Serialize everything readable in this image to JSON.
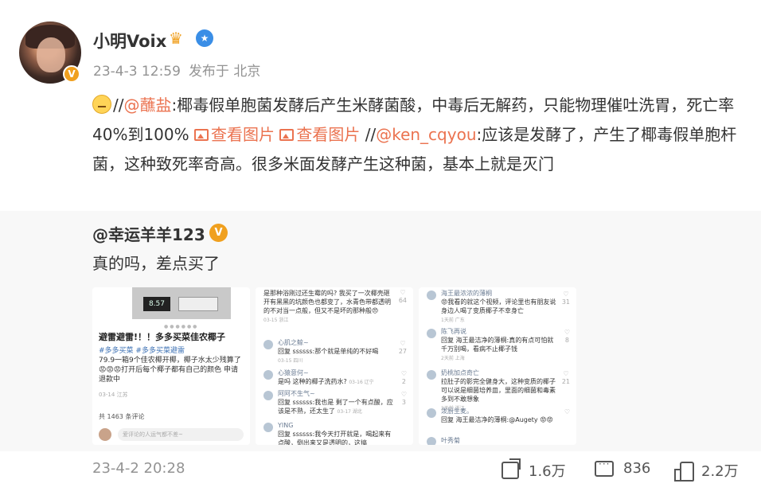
{
  "author": {
    "name": "小明Voix",
    "time": "23-4-3 12:59",
    "source": "发布于 北京"
  },
  "post": {
    "part1": "//",
    "mention1": "@蘸盐",
    "text1": ":椰毒假单胞菌发酵后产生米酵菌酸，中毒后无解药，只能物理催吐洗胃，死亡率40%到100% ",
    "img1": "查看图片",
    "img2": "查看图片",
    "sep": " //",
    "mention2": "@ken_cqyou",
    "text2": ":应该是发酵了，产生了椰毒假单胞杆菌，这种致死率奇高。很多米面发酵产生这种菌，基本上就是灭门"
  },
  "repost": {
    "user": "@幸运羊羊123",
    "text": "真的吗，差点买了",
    "thumb1": {
      "scale_reading": "8.57",
      "title": "避雷避雷!！！多多买菜佳农椰子",
      "tags": "#多多买菜 #多多买菜避雷",
      "body": "79.9一箱9个佳农椰开椰，椰子水太少残算了 😡😡😡打开后每个椰子都有自己的颜色 申请退款中",
      "date": "03-14 江苏",
      "count": "共 1463 条评论",
      "input": "爱评论的人运气都不差~"
    },
    "thumb2": {
      "lines": [
        {
          "name": "",
          "text": "是那种浴刚过还生霉的吗? 我买了一次椰壳砸开有黑黑的坑颜色也都变了，水青色带都透明的不对当一点般，但又不是坏的那种般😠",
          "meta": "03-15 浙江",
          "likes": "64"
        },
        {
          "name": "心肌之鲸~",
          "text": "回复 ssssss:那个就是单纯的不好喝",
          "meta": "03-15 四川",
          "likes": "27"
        },
        {
          "name": "心猿意何~",
          "text": "是吗 这种的椰子洗药水?",
          "meta": "03-16 辽宁",
          "likes": "2"
        },
        {
          "name": "阿阿不生气~",
          "text": "回复 ssssss:我也是 剩了一个有点酸，应该是不熟，还太生了",
          "meta": "03-17 湖北",
          "likes": "3"
        },
        {
          "name": "YING",
          "text": "回复 ssssss:我今天打开就是，喝起来有点酸，倒出来又是透明的，这搞",
          "meta": "",
          "likes": ""
        }
      ]
    },
    "thumb3": {
      "lines": [
        {
          "name": "海王最浓浓的薄桐",
          "text": "😡我看的就这个视频，评论里也有朋友说身边人喝了变质椰子不幸身亡",
          "meta": "1天前 广东",
          "likes": "31"
        },
        {
          "name": "陈飞再说",
          "text": "回复 海王最洁净的薄桐:真的有点可怕就千万别喝，看病不止椰子钱",
          "meta": "2天前 上海",
          "likes": "8"
        },
        {
          "name": "奶桃加点奇亡",
          "text": "拉肚子的影完全健身大，这种变质的椰子可以说是细菌培养皿，里面的细菌和毒素多到不敢想象",
          "meta": "2天前 浙江",
          "likes": "21"
        },
        {
          "name": "泼厨生麦。",
          "text": "回复 海王最洁净的薄桐:@Augety 😡😡",
          "meta": "",
          "likes": ""
        },
        {
          "name": "叶秀菊",
          "text": "",
          "meta": "",
          "likes": ""
        }
      ]
    }
  },
  "footer": {
    "time": "23-4-2 20:28",
    "share": "1.6万",
    "comments": "836",
    "likes": "2.2万"
  },
  "colors": {
    "accent": "#eb7350",
    "badge": "#f0a01f",
    "repost_bg": "#f8f8f8"
  }
}
